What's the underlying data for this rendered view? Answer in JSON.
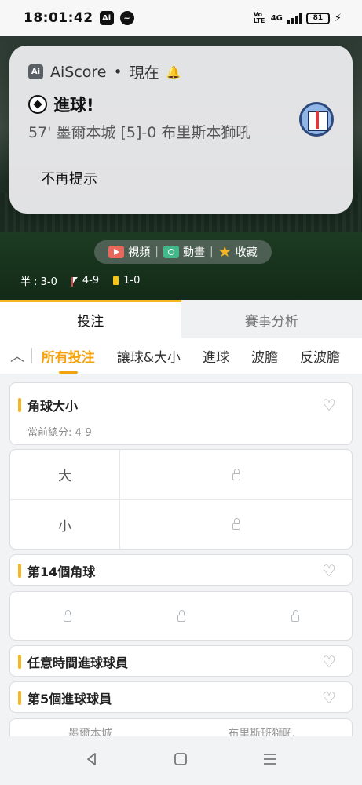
{
  "status_bar": {
    "time": "18:01:42",
    "app_icon_label": "Ai",
    "network": "4G",
    "volte": "Vo LTE",
    "battery": "81"
  },
  "notification": {
    "app_name": "AiScore",
    "separator": "•",
    "time": "現在",
    "app_icon_label": "Ai",
    "title": "進球!",
    "body": "57' 墨爾本城 [5]-0 布里斯本獅吼",
    "action": "不再提示"
  },
  "hero": {
    "actions": [
      {
        "label": "視頻",
        "icon": "video-icon"
      },
      {
        "label": "動畫",
        "icon": "animation-icon"
      },
      {
        "label": "收藏",
        "icon": "star-icon"
      }
    ],
    "stats": {
      "half_label": "半 : 3-0",
      "corners": "4-9",
      "cards": "1-0"
    }
  },
  "tabs": [
    {
      "label": "投注",
      "active": true
    },
    {
      "label": "賽事分析",
      "active": false
    }
  ],
  "subtabs": [
    {
      "label": "所有投注",
      "active": true
    },
    {
      "label": "讓球&大小",
      "active": false
    },
    {
      "label": "進球",
      "active": false
    },
    {
      "label": "波膽",
      "active": false
    },
    {
      "label": "反波膽",
      "active": false
    }
  ],
  "markets": {
    "corner_ou": {
      "title": "角球大小",
      "subtitle": "當前總分: 4-9",
      "rows": [
        "大",
        "小"
      ]
    },
    "corner_14": {
      "title": "第14個角球"
    },
    "anytime_scorer": {
      "title": "任意時間進球球員"
    },
    "fifth_scorer": {
      "title": "第5個進球球員",
      "teams": [
        "墨爾本城",
        "布里斯班獅吼"
      ]
    }
  },
  "colors": {
    "accent": "#f5b621",
    "active_subtab": "#f5a20e"
  }
}
